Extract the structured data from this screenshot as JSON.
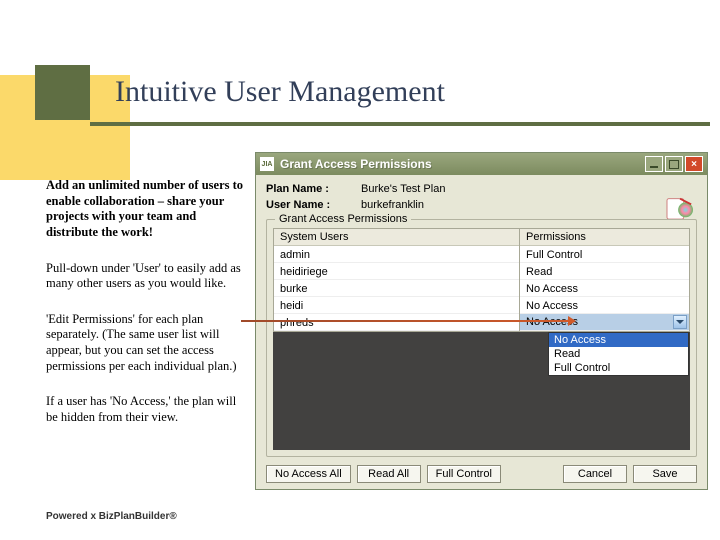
{
  "slide": {
    "title": "Intuitive User Management",
    "bullets": [
      "Add an unlimited number of users to enable collaboration – share your projects with your team and distribute the work!",
      "Pull-down under 'User' to easily add as many other users as you would like.",
      "'Edit Permissions' for each plan separately.\n(The same user list will appear, but you can set the access permissions per each individual plan.)",
      "If a user has 'No Access,' the plan will be hidden from their view."
    ],
    "footer": "Powered x BizPlanBuilder®"
  },
  "dialog": {
    "title": "Grant Access Permissions",
    "app_icon": "JIA",
    "plan_label": "Plan Name :",
    "plan_value": "Burke's Test Plan",
    "user_label": "User Name :",
    "user_value": "burkefranklin",
    "group_legend": "Grant Access Permissions",
    "columns": {
      "users": "System Users",
      "perms": "Permissions"
    },
    "rows": [
      {
        "user": "admin",
        "perm": "Full Control"
      },
      {
        "user": "heidiriege",
        "perm": "Read"
      },
      {
        "user": "burke",
        "perm": "No Access"
      },
      {
        "user": "heidi",
        "perm": "No Access"
      },
      {
        "user": "phreds",
        "perm": "No Access"
      }
    ],
    "dropdown_options": [
      "No Access",
      "Read",
      "Full Control"
    ],
    "buttons": {
      "no_access_all": "No Access  All",
      "read_all": "Read All",
      "full_control": "Full Control",
      "cancel": "Cancel",
      "save": "Save"
    }
  }
}
